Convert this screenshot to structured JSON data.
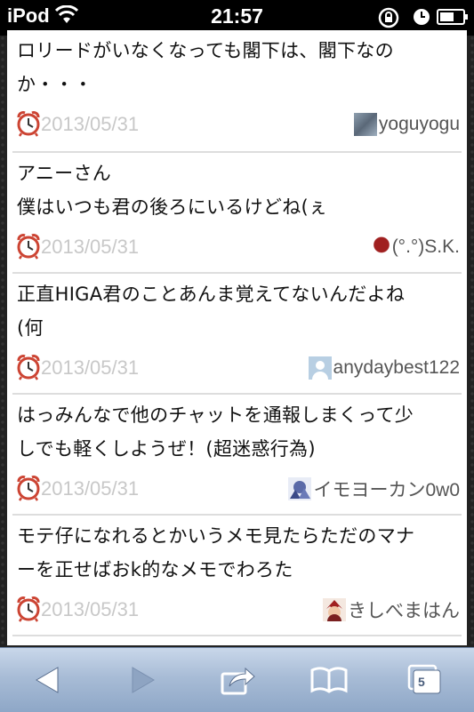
{
  "status_bar": {
    "carrier": "iPod",
    "time": "21:57"
  },
  "posts": [
    {
      "text_lines": [
        "ロリードがいなくなっても閣下は、閣下なの",
        "か・・・"
      ],
      "date": "2013/05/31",
      "user": "yoguyogu",
      "avatar_color": "#7a8a9a"
    },
    {
      "text_lines": [
        "アニーさん",
        "僕はいつも君の後ろにいるけどね(ぇ"
      ],
      "date": "2013/05/31",
      "user": "(°.°)S.K.",
      "avatar_color": "#8b1a1a"
    },
    {
      "text_lines": [
        "正直HIGA君のことあんま覚えてないんだよね",
        "(何"
      ],
      "date": "2013/05/31",
      "user": "anydaybest122",
      "avatar_color": "#a9c4dc"
    },
    {
      "text_lines": [
        "はっみんなで他のチャットを通報しまくって少",
        "しでも軽くしようぜ！(超迷惑行為)"
      ],
      "date": "2013/05/31",
      "user": "イモヨーカン0w0",
      "avatar_color": "#5a6aa8"
    },
    {
      "text_lines": [
        "モテ仔になれるとかいうメモ見たらただのマナ",
        "ーを正せばおk的なメモでわろた"
      ],
      "date": "2013/05/31",
      "user": "きしべまはん",
      "avatar_color": "#b03030"
    }
  ],
  "toolbar": {
    "tab_count": "5"
  }
}
